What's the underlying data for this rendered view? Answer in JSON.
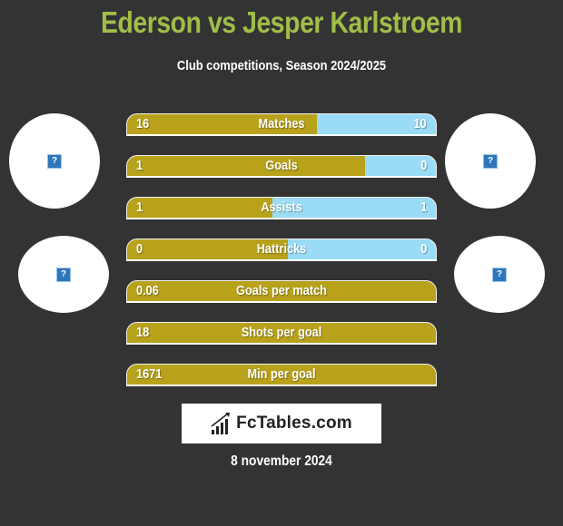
{
  "header": {
    "title": "Ederson vs Jesper Karlstroem",
    "subtitle": "Club competitions, Season 2024/2025"
  },
  "players": {
    "left": {
      "name": "Ederson",
      "avatar_icon": "missing-image-icon",
      "club_icon": "missing-image-icon"
    },
    "right": {
      "name": "Jesper Karlstroem",
      "avatar_icon": "missing-image-icon",
      "club_icon": "missing-image-icon"
    },
    "placeholder_glyph": "?"
  },
  "colors": {
    "background": "#333333",
    "title": "#a0be48",
    "left_bar": "#b8a21b",
    "right_bar": "#9adcf5"
  },
  "stats": [
    {
      "label": "Matches",
      "left": "16",
      "right": "10",
      "left_share": 0.615
    },
    {
      "label": "Goals",
      "left": "1",
      "right": "0",
      "left_share": 0.77
    },
    {
      "label": "Assists",
      "left": "1",
      "right": "1",
      "left_share": 0.47
    },
    {
      "label": "Hattricks",
      "left": "0",
      "right": "0",
      "left_share": 0.52
    },
    {
      "label": "Goals per match",
      "left": "0.06",
      "right": "",
      "left_share": 1.0
    },
    {
      "label": "Shots per goal",
      "left": "18",
      "right": "",
      "left_share": 1.0
    },
    {
      "label": "Min per goal",
      "left": "1671",
      "right": "",
      "left_share": 1.0
    }
  ],
  "footer": {
    "logo_text": "FcTables.com",
    "logo_icon": "bar-chart-icon",
    "date": "8 november 2024"
  }
}
